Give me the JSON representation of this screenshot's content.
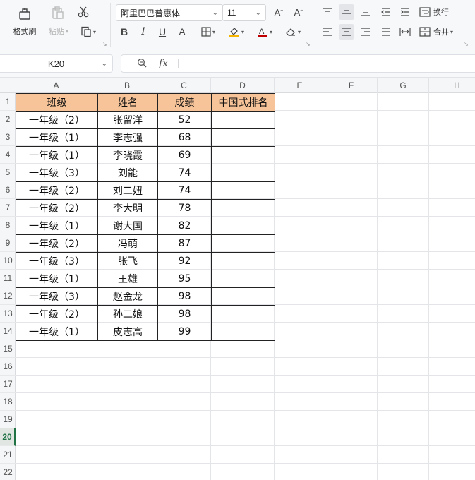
{
  "ribbon": {
    "format_painter_label": "格式刷",
    "paste_label": "粘贴",
    "font_name": "阿里巴巴普惠体",
    "font_size": "11",
    "wrap_label": "换行",
    "merge_label": "合并"
  },
  "formula_bar": {
    "cell_ref": "K20",
    "formula": ""
  },
  "sheet": {
    "columns": [
      "A",
      "B",
      "C",
      "D",
      "E",
      "F",
      "G",
      "H"
    ],
    "rows": [
      "1",
      "2",
      "3",
      "4",
      "5",
      "6",
      "7",
      "8",
      "9",
      "10",
      "11",
      "12",
      "13",
      "14",
      "15",
      "16",
      "17",
      "18",
      "19",
      "20",
      "21",
      "22"
    ],
    "selected_row": "20",
    "headers": [
      "班级",
      "姓名",
      "成绩",
      "中国式排名"
    ],
    "records": [
      [
        "一年级（2）",
        "张留洋",
        "52",
        ""
      ],
      [
        "一年级（1）",
        "李志强",
        "68",
        ""
      ],
      [
        "一年级（1）",
        "李晓霞",
        "69",
        ""
      ],
      [
        "一年级（3）",
        "刘能",
        "74",
        ""
      ],
      [
        "一年级（2）",
        "刘二妞",
        "74",
        ""
      ],
      [
        "一年级（2）",
        "李大明",
        "78",
        ""
      ],
      [
        "一年级（1）",
        "谢大国",
        "82",
        ""
      ],
      [
        "一年级（2）",
        "冯萌",
        "87",
        ""
      ],
      [
        "一年级（3）",
        "张飞",
        "92",
        ""
      ],
      [
        "一年级（1）",
        "王雄",
        "95",
        ""
      ],
      [
        "一年级（3）",
        "赵金龙",
        "98",
        ""
      ],
      [
        "一年级（2）",
        "孙二娘",
        "98",
        ""
      ],
      [
        "一年级（1）",
        "皮志高",
        "99",
        ""
      ]
    ]
  },
  "colors": {
    "header_fill": "#f7c499",
    "accent": "#217346"
  },
  "icons": [
    "format-painter-icon",
    "paste-icon",
    "cut-icon",
    "copy-icon",
    "bold-icon",
    "italic-icon",
    "underline-icon",
    "strikethrough-icon",
    "border-icon",
    "fill-color-icon",
    "font-color-icon",
    "clear-icon",
    "increase-font-icon",
    "decrease-font-icon",
    "align-top-icon",
    "align-middle-icon",
    "align-bottom-icon",
    "indent-decrease-icon",
    "indent-increase-icon",
    "wrap-icon",
    "align-left-icon",
    "align-center-icon",
    "align-right-icon",
    "justify-icon",
    "distribute-icon",
    "merge-icon",
    "zoom-icon",
    "fx-icon"
  ]
}
